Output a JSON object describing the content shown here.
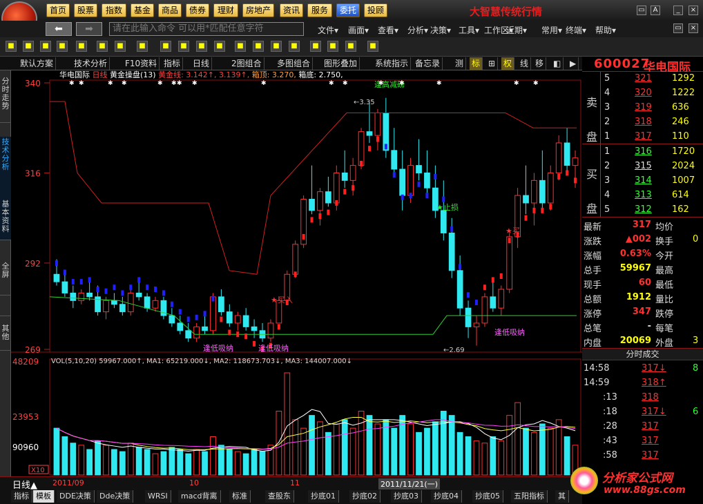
{
  "app": {
    "title": "大智慧传统行情"
  },
  "top_menu": [
    "首页",
    "股票",
    "指数",
    "基金",
    "商品",
    "债券",
    "理财",
    "房地产",
    "资讯",
    "服务",
    "委托",
    "投顾"
  ],
  "nav": {
    "back": "⬅",
    "fwd": "➡",
    "cmd_placeholder": "请在此输入命令  可以用*匹配任意字符",
    "menus": [
      "文件▾",
      "画面▾",
      "查看▾",
      "分析▾",
      "决策▾",
      "工具▾",
      "工作区▾",
      "近期▾",
      "常用▾",
      "终端▾",
      "帮助▾"
    ]
  },
  "tabs": [
    "默认方案",
    "技术分析",
    "F10资料",
    "指标",
    "日线",
    "2图组合",
    "多图组合",
    "图形叠加",
    "系统指示",
    "备忘录",
    "测",
    "标",
    "⊞",
    "权",
    "线",
    "移",
    "◧",
    "▶"
  ],
  "left_nav": [
    "分时走势",
    "技术分析",
    "基本资料",
    "全屏",
    "其他"
  ],
  "stock": {
    "code": "600027",
    "name": "华电国际"
  },
  "chart": {
    "header_name": "华电国际",
    "header_period": "日线",
    "header_indicator": "黄金操盘(13)",
    "gold_line": "黄金线: 3.142↑, 3.139↑",
    "box_top": "箱顶: 3.270",
    "box_bottom": "箱底: 2.750",
    "y_labels": [
      "340",
      "316",
      "292",
      "269"
    ],
    "annotations": {
      "high": "3.35",
      "low": "2.69",
      "sell_tip": "逢高减磅",
      "stop": "止损",
      "buy": "买入",
      "buy2": "买",
      "low_tip1": "逢低吸纳",
      "low_tip2": "逢低吸纳",
      "low_tip3": "逢低吸纳"
    },
    "vol_header": "VOL(5,10,20) 59967.000↑, MA1: 65219.000↓, MA2: 118673.703↓, MA3: 144007.000↓",
    "vol_labels": [
      "48209",
      "23953",
      "90960"
    ],
    "vol_unit": "X10",
    "dates": [
      "2011/09",
      "10",
      "11",
      "2011/11/21(一)"
    ]
  },
  "chart_data": {
    "type": "candlestick",
    "y_range": [
      269,
      340
    ],
    "candles": [
      [
        289,
        293,
        286,
        287
      ],
      [
        287,
        289,
        283,
        284
      ],
      [
        284,
        286,
        280,
        282
      ],
      [
        282,
        285,
        281,
        284
      ],
      [
        284,
        287,
        282,
        283
      ],
      [
        283,
        286,
        278,
        279
      ],
      [
        279,
        283,
        277,
        282
      ],
      [
        282,
        284,
        280,
        281
      ],
      [
        281,
        283,
        278,
        279
      ],
      [
        279,
        285,
        278,
        284
      ],
      [
        284,
        287,
        282,
        283
      ],
      [
        283,
        284,
        279,
        280
      ],
      [
        280,
        283,
        279,
        282
      ],
      [
        282,
        283,
        277,
        278
      ],
      [
        278,
        280,
        275,
        276
      ],
      [
        276,
        278,
        273,
        274
      ],
      [
        274,
        276,
        271,
        272
      ],
      [
        272,
        276,
        271,
        275
      ],
      [
        275,
        278,
        273,
        274
      ],
      [
        274,
        284,
        273,
        283
      ],
      [
        283,
        285,
        278,
        279
      ],
      [
        279,
        281,
        275,
        276
      ],
      [
        276,
        279,
        274,
        278
      ],
      [
        278,
        280,
        274,
        275
      ],
      [
        275,
        277,
        272,
        274
      ],
      [
        274,
        276,
        271,
        272
      ],
      [
        272,
        277,
        271,
        276
      ],
      [
        276,
        283,
        276,
        282
      ],
      [
        282,
        290,
        281,
        289
      ],
      [
        289,
        298,
        288,
        297
      ],
      [
        297,
        310,
        296,
        309
      ],
      [
        309,
        318,
        305,
        306
      ],
      [
        306,
        312,
        302,
        311
      ],
      [
        311,
        315,
        307,
        308
      ],
      [
        308,
        318,
        306,
        316
      ],
      [
        316,
        322,
        312,
        314
      ],
      [
        314,
        320,
        310,
        318
      ],
      [
        318,
        328,
        317,
        327
      ],
      [
        327,
        335,
        324,
        326
      ],
      [
        326,
        333,
        322,
        332
      ],
      [
        332,
        336,
        320,
        322
      ],
      [
        322,
        328,
        315,
        317
      ],
      [
        317,
        322,
        306,
        310
      ],
      [
        310,
        320,
        308,
        318
      ],
      [
        318,
        325,
        314,
        316
      ],
      [
        316,
        322,
        310,
        312
      ],
      [
        312,
        318,
        304,
        306
      ],
      [
        306,
        314,
        298,
        300
      ],
      [
        300,
        304,
        288,
        290
      ],
      [
        290,
        294,
        278,
        280
      ],
      [
        280,
        282,
        272,
        275
      ],
      [
        275,
        278,
        270,
        276
      ],
      [
        276,
        284,
        275,
        283
      ],
      [
        283,
        288,
        279,
        280
      ],
      [
        280,
        286,
        278,
        285
      ],
      [
        285,
        300,
        284,
        299
      ],
      [
        299,
        312,
        296,
        310
      ],
      [
        310,
        318,
        305,
        308
      ],
      [
        308,
        316,
        302,
        314
      ],
      [
        314,
        322,
        306,
        308
      ],
      [
        308,
        318,
        306,
        316
      ],
      [
        316,
        326,
        314,
        324
      ],
      [
        324,
        328,
        316,
        318
      ],
      [
        318,
        322,
        312,
        320
      ]
    ],
    "volume": [
      22,
      18,
      15,
      14,
      12,
      16,
      14,
      12,
      11,
      15,
      13,
      12,
      10,
      11,
      13,
      12,
      10,
      12,
      11,
      18,
      14,
      12,
      11,
      10,
      12,
      11,
      14,
      30,
      48,
      26,
      22,
      28,
      25,
      20,
      24,
      26,
      22,
      30,
      28,
      24,
      26,
      22,
      28,
      24,
      20,
      22,
      25,
      30,
      28,
      20,
      18,
      16,
      15,
      18,
      16,
      28,
      34,
      22,
      20,
      24,
      22,
      26,
      18,
      14
    ],
    "volume_max": 48209,
    "quote": {
      "ask": [
        [
          "5",
          "321",
          "1292"
        ],
        [
          "4",
          "320",
          "1222"
        ],
        [
          "3",
          "319",
          "636"
        ],
        [
          "2",
          "318",
          "246"
        ],
        [
          "1",
          "317",
          "110"
        ]
      ],
      "bid": [
        [
          "1",
          "316",
          "1720"
        ],
        [
          "2",
          "315",
          "2024"
        ],
        [
          "3",
          "314",
          "1007"
        ],
        [
          "4",
          "313",
          "614"
        ],
        [
          "5",
          "312",
          "162"
        ]
      ]
    }
  },
  "quote_labels": {
    "sell": "卖盘",
    "buy": "买盘"
  },
  "stats": [
    [
      "最新",
      "317",
      "均价",
      ""
    ],
    [
      "涨跌",
      "▲002",
      "换手",
      "0"
    ],
    [
      "涨幅",
      "0.63%",
      "今开",
      ""
    ],
    [
      "总手",
      "59967",
      "最高",
      ""
    ],
    [
      "现手",
      "60",
      "最低",
      ""
    ],
    [
      "总额",
      "1912",
      "量比",
      ""
    ],
    [
      "涨停",
      "347",
      "跌停",
      ""
    ],
    [
      "总笔",
      "-",
      "每笔",
      ""
    ],
    [
      "内盘",
      "20069",
      "外盘",
      "3"
    ]
  ],
  "ticks_title": "分时成交",
  "ticks": [
    [
      "14:58",
      "317↓",
      "8"
    ],
    [
      "14:59",
      "318↑",
      ""
    ],
    [
      ":13",
      "318",
      ""
    ],
    [
      ":18",
      "317↓",
      "6"
    ],
    [
      ":28",
      "317",
      ""
    ],
    [
      ":43",
      "317",
      ""
    ],
    [
      ":58",
      "317",
      ""
    ]
  ],
  "bottom": {
    "period": "日线▲",
    "tabs": [
      "指标",
      "模板",
      "DDE决策",
      "Dde决策",
      "WRSI",
      "macd背离",
      "标准",
      "查股东",
      "抄底01",
      "抄底02",
      "抄底03",
      "抄底04",
      "抄底05",
      "五阳指标",
      "其"
    ]
  },
  "watermark": {
    "text": "分析家公式网",
    "url": "www.88gs.com"
  }
}
